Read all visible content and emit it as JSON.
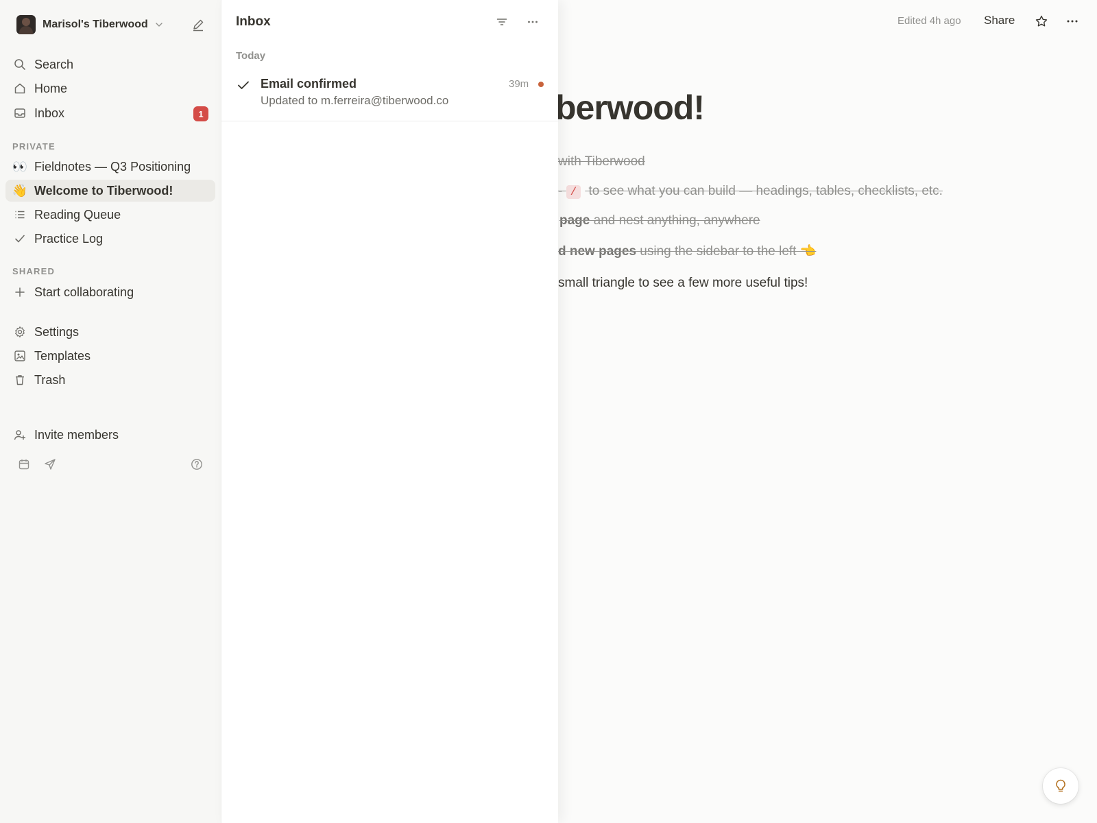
{
  "sidebar": {
    "workspace_name": "Marisol's Tiberwood",
    "nav": {
      "search": "Search",
      "home": "Home",
      "inbox": "Inbox",
      "inbox_badge": "1"
    },
    "private_label": "PRIVATE",
    "private_pages": [
      {
        "emoji": "👀",
        "label": "Fieldnotes — Q3 Positioning"
      },
      {
        "emoji": "👋",
        "label": "Welcome to Tiberwood!"
      },
      {
        "emoji": "",
        "label": "Reading Queue"
      },
      {
        "emoji": "",
        "label": "Practice Log"
      }
    ],
    "shared_label": "SHARED",
    "start_collaborating": "Start collaborating",
    "settings": "Settings",
    "templates": "Templates",
    "trash": "Trash",
    "invite_members": "Invite members"
  },
  "inbox": {
    "title": "Inbox",
    "group_label": "Today",
    "notification": {
      "title": "Email confirmed",
      "subtitle": "Updated to m.ferreira@tiberwood.co",
      "time": "39m"
    }
  },
  "page": {
    "edited": "Edited 4h ago",
    "share": "Share",
    "title_visible": "berwood!",
    "todo_1": "with Tiberwood",
    "todo_2_prefix": "-",
    "todo_2_code": "/",
    "todo_2_text": "to see what you can build — headings, tables, checklists, etc.",
    "todo_3_bold": "page",
    "todo_3_text": " and nest anything, anywhere",
    "todo_4_bold": "d new pages",
    "todo_4_text": " using the sidebar to the left 👈",
    "tip": "small triangle to see a few more useful tips!"
  },
  "colors": {
    "accent_badge": "#d44c47",
    "unread_dot": "#c8633c",
    "sidebar_bg": "#f7f7f5",
    "active_item_bg": "#ebeae6"
  }
}
